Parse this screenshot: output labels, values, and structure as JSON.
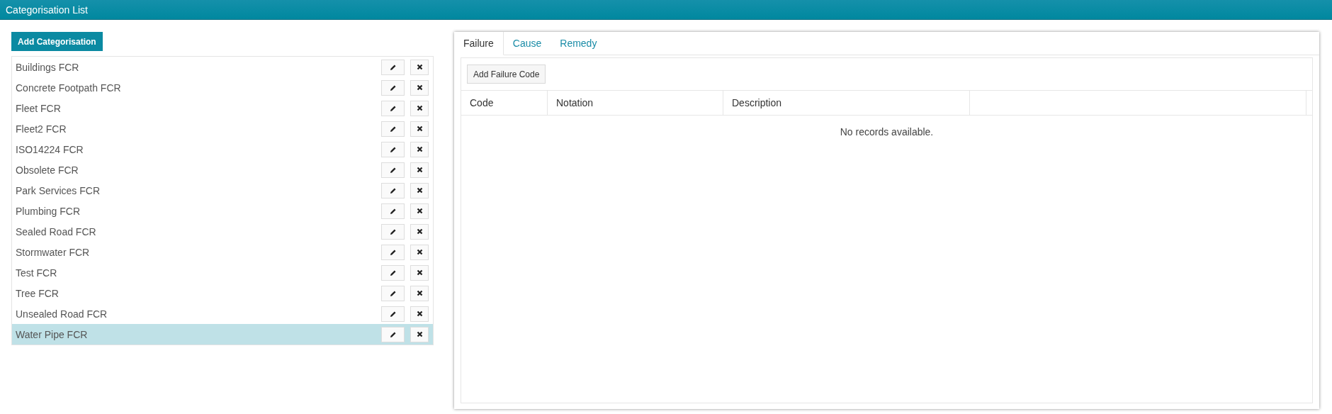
{
  "header": {
    "title": "Categorisation List"
  },
  "add_button": "Add Categorisation",
  "categories": [
    {
      "name": "Buildings FCR",
      "selected": false
    },
    {
      "name": "Concrete Footpath FCR",
      "selected": false
    },
    {
      "name": "Fleet FCR",
      "selected": false
    },
    {
      "name": "Fleet2 FCR",
      "selected": false
    },
    {
      "name": "ISO14224 FCR",
      "selected": false
    },
    {
      "name": "Obsolete FCR",
      "selected": false
    },
    {
      "name": "Park Services FCR",
      "selected": false
    },
    {
      "name": "Plumbing FCR",
      "selected": false
    },
    {
      "name": "Sealed Road FCR",
      "selected": false
    },
    {
      "name": "Stormwater FCR",
      "selected": false
    },
    {
      "name": "Test FCR",
      "selected": false
    },
    {
      "name": "Tree FCR",
      "selected": false
    },
    {
      "name": "Unsealed Road FCR",
      "selected": false
    },
    {
      "name": "Water Pipe FCR",
      "selected": true
    }
  ],
  "tabs": [
    {
      "label": "Failure",
      "selected": true
    },
    {
      "label": "Cause",
      "selected": false
    },
    {
      "label": "Remedy",
      "selected": false
    }
  ],
  "panel": {
    "add_button": "Add Failure Code",
    "table": {
      "columns": [
        "Code",
        "Notation",
        "Description"
      ],
      "empty_message": "No records available."
    }
  }
}
